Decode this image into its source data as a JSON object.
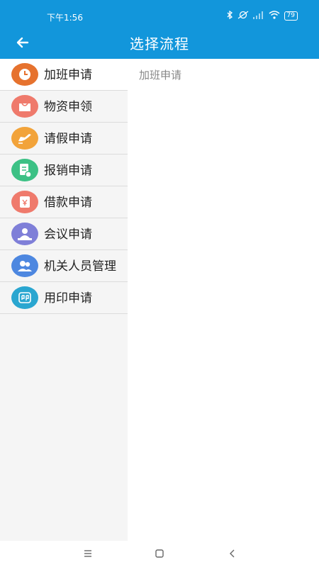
{
  "status_bar": {
    "time": "下午1:56",
    "battery": "79"
  },
  "app_bar": {
    "title": "选择流程",
    "back_icon": "arrow-left-icon"
  },
  "sidebar": {
    "selected_index": 0,
    "items": [
      {
        "label": "加班申请",
        "icon": "clock-icon",
        "color": "#e6722e"
      },
      {
        "label": "物资申领",
        "icon": "bag-icon",
        "color": "#ef7a6c"
      },
      {
        "label": "请假申请",
        "icon": "airplane-icon",
        "color": "#f2a33a"
      },
      {
        "label": "报销申请",
        "icon": "receipt-icon",
        "color": "#3cc185"
      },
      {
        "label": "借款申请",
        "icon": "money-envelope-icon",
        "color": "#ef7a6c"
      },
      {
        "label": "会议申请",
        "icon": "meeting-icon",
        "color": "#7f7fd8"
      },
      {
        "label": "机关人员管理",
        "icon": "people-icon",
        "color": "#4d87e0"
      },
      {
        "label": "用印申请",
        "icon": "stamp-icon",
        "color": "#2aa6d0"
      }
    ]
  },
  "content": {
    "title": "加班申请"
  },
  "colors": {
    "primary": "#1296db",
    "sidebar_bg": "#f5f5f5"
  }
}
